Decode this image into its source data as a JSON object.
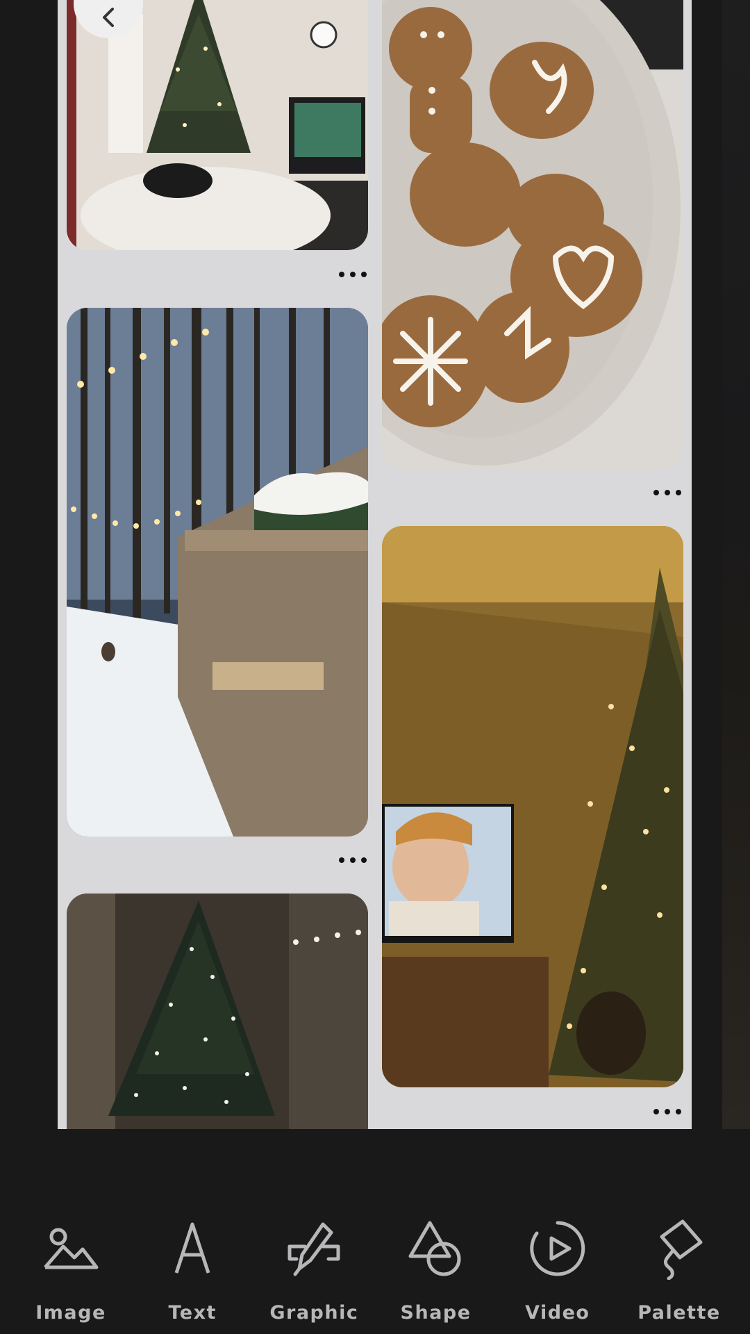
{
  "toolbar": {
    "items": [
      {
        "label": "Image",
        "icon": "image-icon"
      },
      {
        "label": "Text",
        "icon": "text-icon"
      },
      {
        "label": "Graphic",
        "icon": "graphic-icon"
      },
      {
        "label": "Shape",
        "icon": "shape-icon"
      },
      {
        "label": "Video",
        "icon": "video-icon"
      },
      {
        "label": "Palette",
        "icon": "palette-icon"
      }
    ]
  },
  "canvas": {
    "pins": [
      {
        "subject": "living room christmas tree with tv",
        "column": "left"
      },
      {
        "subject": "gingerbread cookies on plate",
        "column": "right"
      },
      {
        "subject": "snowy forest market stall with string lights",
        "column": "left"
      },
      {
        "subject": "christmas tree with tv in warm room",
        "column": "right"
      },
      {
        "subject": "dark christmas tree with lights",
        "column": "left"
      }
    ]
  },
  "colors": {
    "background": "#19191a",
    "page": "#d9d9db",
    "toolbar_label": "#b7b7b9"
  }
}
